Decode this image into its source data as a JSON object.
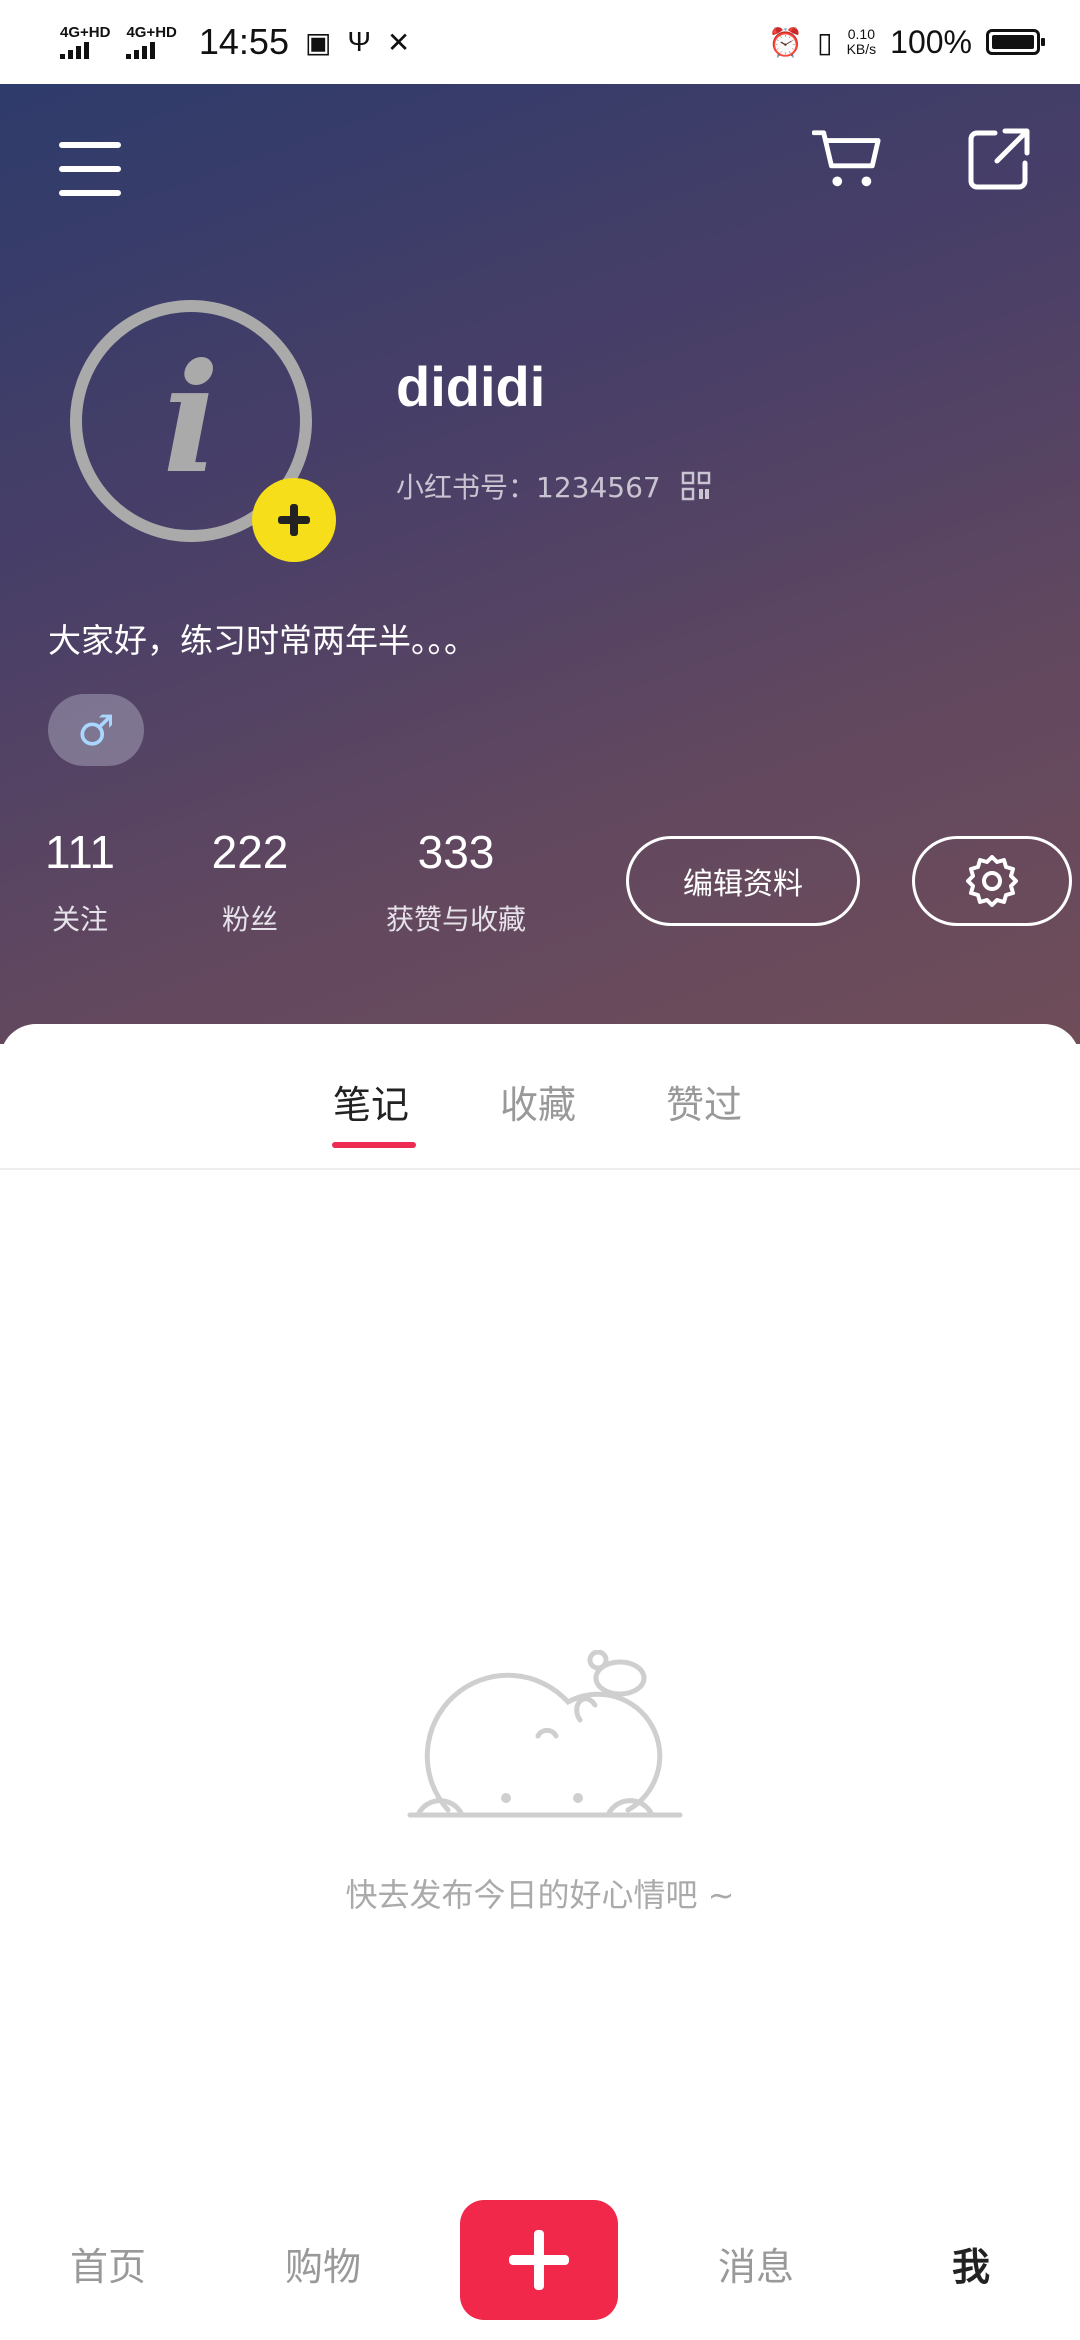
{
  "status_bar": {
    "network1": "4G+HD",
    "network2": "4G+HD",
    "time": "14:55",
    "speed_value": "0.10",
    "speed_unit": "KB/s",
    "battery": "100%"
  },
  "header": {
    "username": "dididi",
    "user_id": "小红书号：1234567",
    "bio": "大家好，练习时常两年半。。。",
    "gender_symbol": "♂",
    "stats": [
      {
        "value": "111",
        "label": "关注"
      },
      {
        "value": "222",
        "label": "粉丝"
      },
      {
        "value": "333",
        "label": "获赞与收藏"
      }
    ],
    "edit_profile_label": "编辑资料"
  },
  "tabs": [
    "笔记",
    "收藏",
    "赞过"
  ],
  "empty_state": {
    "text": "快去发布今日的好心情吧 ~"
  },
  "bottom_nav": {
    "home": "首页",
    "shop": "购物",
    "messages": "消息",
    "me": "我"
  },
  "colors": {
    "accent": "#f2284a",
    "tab_indicator": "#ee2b52",
    "avatar_badge": "#f7de1a"
  }
}
